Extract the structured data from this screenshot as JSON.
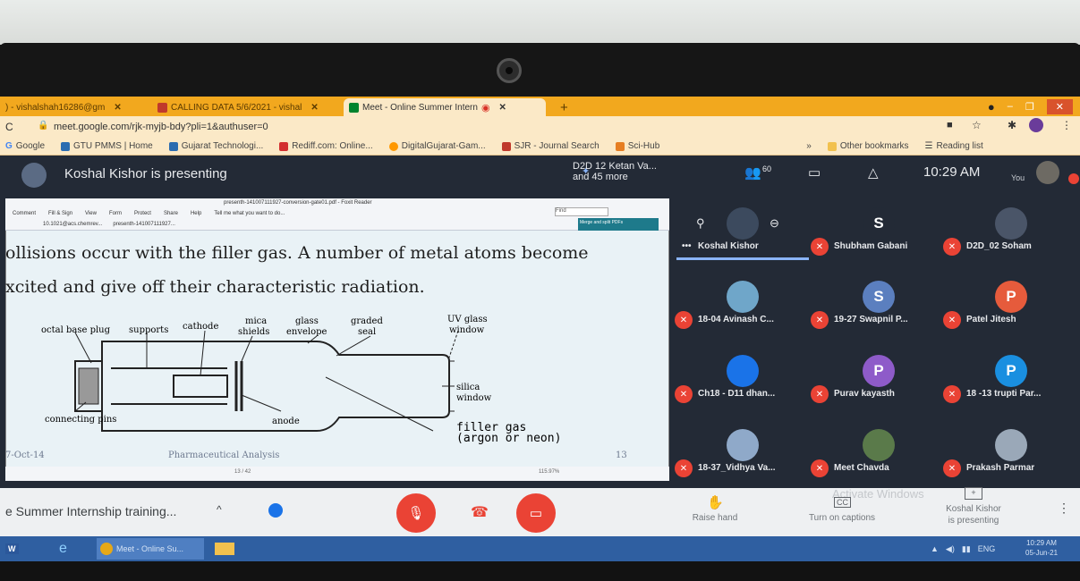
{
  "browser": {
    "tabs": [
      {
        "label": ") - vishalshah16286@gm",
        "active": false
      },
      {
        "label": "CALLING DATA 5/6/2021 - vishal",
        "active": false
      },
      {
        "label": "Meet - Online Summer Intern",
        "active": true
      }
    ],
    "url": "meet.google.com/rjk-myjb-bdy?pli=1&authuser=0",
    "bookmarks": [
      {
        "label": "Google",
        "color": "#4285f4"
      },
      {
        "label": "GTU PMMS | Home",
        "color": "#2b6cb0"
      },
      {
        "label": "Gujarat Technologi...",
        "color": "#2b6cb0"
      },
      {
        "label": "Rediff.com: Online...",
        "color": "#d32f2f"
      },
      {
        "label": "DigitalGujarat-Gam...",
        "color": "#ff9800"
      },
      {
        "label": "SJR - Journal Search",
        "color": "#c0392b"
      },
      {
        "label": "Sci-Hub",
        "color": "#e67e22"
      }
    ],
    "other_bookmarks": "Other bookmarks",
    "reading_list": "Reading list"
  },
  "meet": {
    "presenting_text": "Koshal Kishor is presenting",
    "top_participants": "D2D 12 Ketan Va...\nand 45 more",
    "top_participants_line1": "D2D 12 Ketan Va...",
    "top_participants_line2": "and 45 more",
    "participant_count": "60",
    "clock": "10:29 AM",
    "you_label": "You",
    "meeting_title": "e Summer Internship training...",
    "raise_hand": "Raise hand",
    "captions": "Turn on captions",
    "presenting_line1": "Koshal Kishor",
    "presenting_line2": "is presenting",
    "watermark": "Activate Windows"
  },
  "slide": {
    "pdf_title": "presenth-141007111927-conversion-gate01.pdf - Foxit Reader",
    "pdf_menu": [
      "Comment",
      "Fill & Sign",
      "View",
      "Form",
      "Protect",
      "Share",
      "Help",
      "Tell me what you want to do..."
    ],
    "pdf_tabs": [
      "10.1021@acs.chemrev...",
      "presenth-141007111927..."
    ],
    "find": "Find",
    "merge": "Merge and split PDFs",
    "line1": "ollisions occur with the filler gas. A number of metal atoms become",
    "line2": "xcited and give off their characteristic radiation.",
    "footer_date": "7-Oct-14",
    "footer_center": "Pharmaceutical Analysis",
    "footer_page": "13",
    "status": "13 / 42",
    "zoom": "115.97%",
    "diagram_labels": {
      "octal_base_plug": "octal base plug",
      "supports": "supports",
      "cathode": "cathode",
      "mica_shields": "mica shields",
      "mica": "mica",
      "shields": "shields",
      "glass_envelope": "glass envelope",
      "glass": "glass",
      "envelope": "envelope",
      "graded_seal": "graded seal",
      "graded": "graded",
      "seal": "seal",
      "uv_glass_window": "UV glass window",
      "uv_glass": "UV glass",
      "window": "window",
      "silica_window": "silica window",
      "silica": "silica",
      "connecting_pins": "connecting pins",
      "anode": "anode",
      "filler_gas": "filler gas",
      "argon_or_neon": "(argon or neon)"
    }
  },
  "participants": [
    {
      "name": "Koshal Kishor",
      "initial": "",
      "color": "#3c4a5e",
      "muted": false
    },
    {
      "name": "Shubham Gabani",
      "initial": "S",
      "color": "#232a36",
      "muted": true
    },
    {
      "name": "D2D_02 Soham",
      "initial": "",
      "color": "#4a5568",
      "muted": true
    },
    {
      "name": "18-04 Avinash C...",
      "initial": "",
      "color": "#6fa6c9",
      "muted": true
    },
    {
      "name": "19-27 Swapnil P...",
      "initial": "S",
      "color": "#5b7fbf",
      "muted": true
    },
    {
      "name": "Patel Jitesh",
      "initial": "P",
      "color": "#e65b3c",
      "muted": true
    },
    {
      "name": "Ch18 - D11 dhan...",
      "initial": "",
      "color": "#1a73e8",
      "muted": true
    },
    {
      "name": "Purav kayasth",
      "initial": "P",
      "color": "#8e5bc9",
      "muted": true
    },
    {
      "name": "18 -13 trupti Par...",
      "initial": "P",
      "color": "#1a8fe0",
      "muted": true
    },
    {
      "name": "18-37_Vidhya Va...",
      "initial": "",
      "color": "#8fa9c9",
      "muted": true
    },
    {
      "name": "Meet Chavda",
      "initial": "",
      "color": "#5a7a4a",
      "muted": true
    },
    {
      "name": "Prakash Parmar",
      "initial": "",
      "color": "#9aa8b8",
      "muted": true
    }
  ],
  "taskbar": {
    "chrome_label": "Meet - Online Su...",
    "lang": "ENG",
    "time": "10:29 AM",
    "date": "05-Jun-21"
  },
  "colors": {
    "meet_bg": "#232a36",
    "mic_off": "#ea4335",
    "tab_bar": "#f2a81e",
    "taskbar": "#2f5fa1"
  }
}
